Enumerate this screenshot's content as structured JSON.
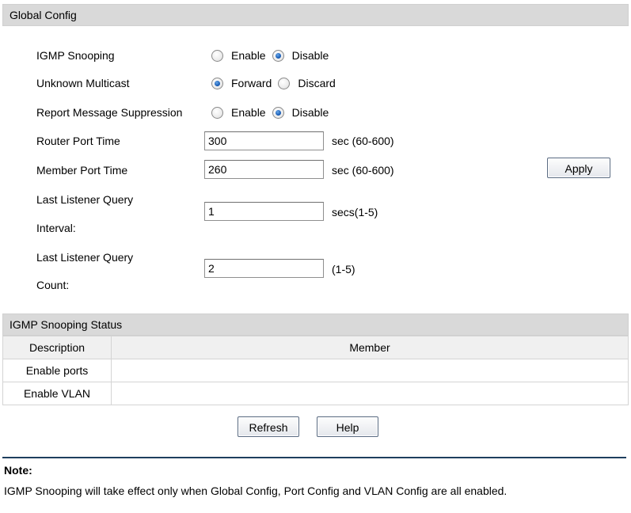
{
  "global_config": {
    "title": "Global Config",
    "igmp_snooping": {
      "label": "IGMP Snooping",
      "options": [
        "Enable",
        "Disable"
      ],
      "selected": "Disable"
    },
    "unknown_multicast": {
      "label": "Unknown Multicast",
      "options": [
        "Forward",
        "Discard"
      ],
      "selected": "Forward"
    },
    "report_suppression": {
      "label": "Report Message Suppression",
      "options": [
        "Enable",
        "Disable"
      ],
      "selected": "Disable"
    },
    "router_port_time": {
      "label": "Router Port Time",
      "value": "300",
      "unit": "sec (60-600)"
    },
    "member_port_time": {
      "label": "Member Port Time",
      "value": "260",
      "unit": "sec (60-600)"
    },
    "last_listener_query_interval": {
      "label_line1": "Last Listener Query",
      "label_line2": "Interval:",
      "value": "1",
      "unit": "secs(1-5)"
    },
    "last_listener_query_count": {
      "label_line1": "Last Listener Query",
      "label_line2": "Count:",
      "value": "2",
      "unit": "(1-5)"
    },
    "apply_label": "Apply"
  },
  "status": {
    "title": "IGMP Snooping Status",
    "columns": [
      "Description",
      "Member"
    ],
    "rows": [
      {
        "description": "Enable ports",
        "member": ""
      },
      {
        "description": "Enable VLAN",
        "member": ""
      }
    ]
  },
  "buttons": {
    "refresh": "Refresh",
    "help": "Help"
  },
  "note": {
    "title": "Note:",
    "text": "IGMP Snooping will take effect only when Global Config, Port Config and VLAN Config are all enabled."
  }
}
